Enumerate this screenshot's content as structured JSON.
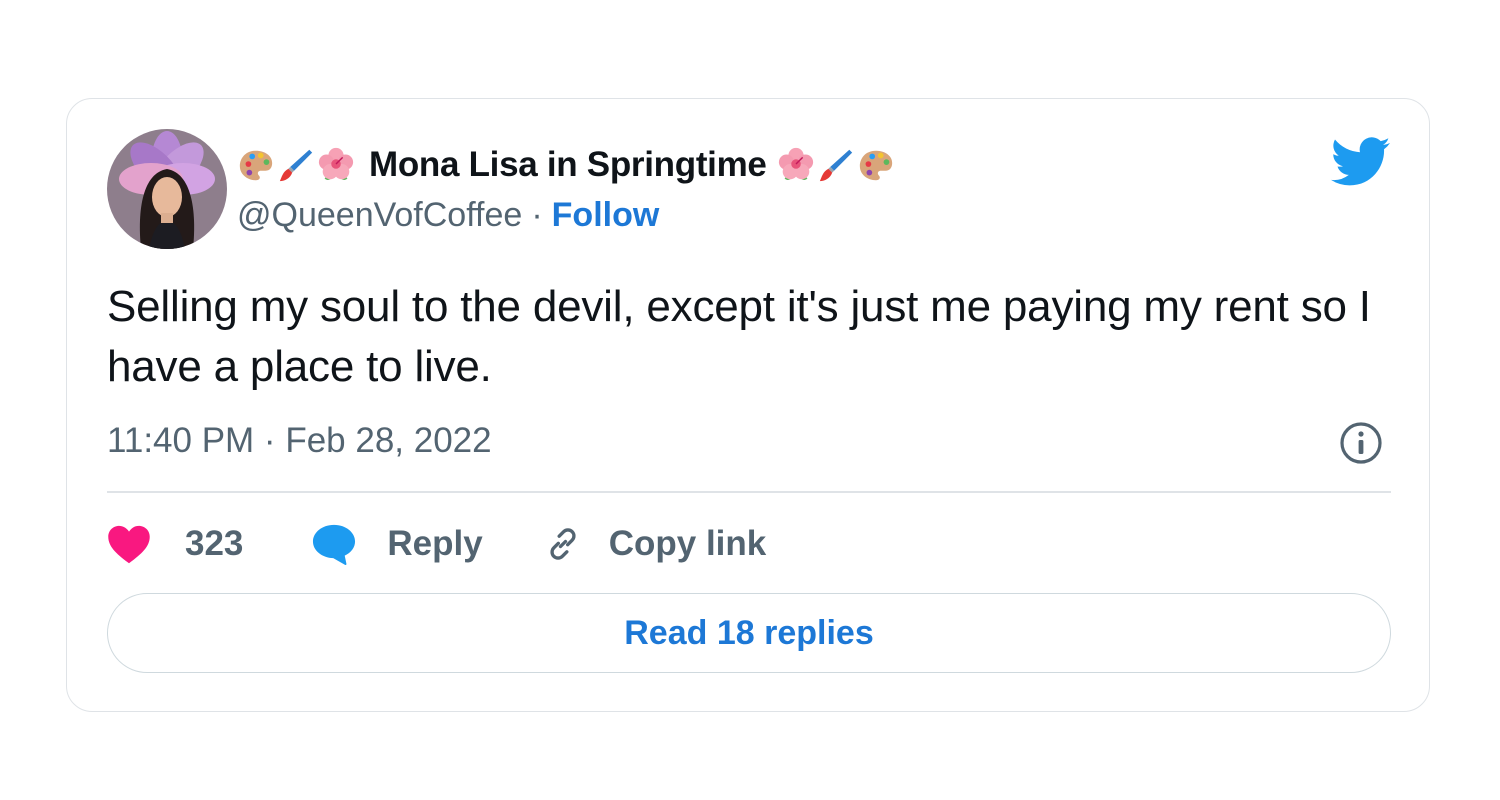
{
  "user": {
    "display_name": "Mona Lisa in Springtime",
    "name_emoji_left": [
      "palette-emoji",
      "paintbrush-emoji",
      "hibiscus-emoji"
    ],
    "name_emoji_right": [
      "hibiscus-emoji",
      "paintbrush-emoji",
      "palette-emoji"
    ],
    "handle": "@QueenVofCoffee",
    "separator": "·",
    "follow_label": "Follow"
  },
  "tweet": {
    "text": "Selling my soul to the devil, except it's just me paying my rent so I have a place to live.",
    "timestamp": "11:40 PM · Feb 28, 2022"
  },
  "actions": {
    "like_count": "323",
    "reply_label": "Reply",
    "copy_link_label": "Copy link"
  },
  "read_replies_label": "Read 18 replies",
  "icons": {
    "brand": "twitter-bird-icon",
    "info": "info-icon",
    "like": "heart-icon",
    "reply": "speech-bubble-icon",
    "copy": "link-icon"
  },
  "colors": {
    "brand_blue": "#1d9bf0",
    "link_blue": "#1d78d6",
    "heart_pink": "#f91880",
    "text_primary": "#0f1419",
    "text_secondary": "#536471",
    "border": "#dfe3e7"
  }
}
